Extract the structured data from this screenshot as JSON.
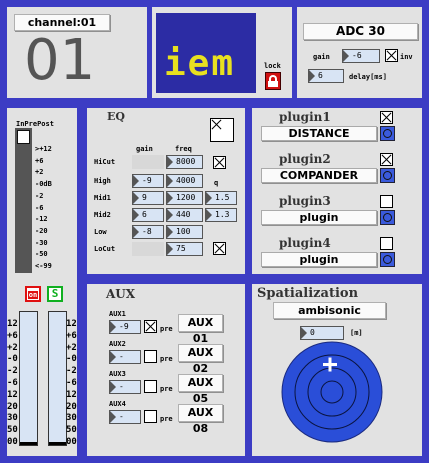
{
  "channel": {
    "title": "channel:01",
    "number": "01"
  },
  "header": {
    "logo_text": "iem",
    "lock_label": "lock",
    "adc_label": "ADC 30",
    "gain_label": "gain",
    "gain_value": "-6",
    "inv_label": "inv",
    "delay_value": "6",
    "delay_label": "delay[ms]"
  },
  "meter": {
    "header": "InPrePost",
    "scale": [
      ">+12",
      "+6",
      "+2",
      "-0dB",
      "-2",
      "-6",
      "-12",
      "-20",
      "-30",
      "-50",
      "<-99"
    ]
  },
  "buttons": {
    "mute": "on",
    "solo": "S"
  },
  "fader_scale": [
    "12",
    "+6",
    "+2",
    "-0",
    "-2",
    "-6",
    "12",
    "20",
    "30",
    "50",
    "00"
  ],
  "eq": {
    "title": "EQ",
    "gain_header": "gain",
    "freq_header": "freq",
    "q_header": "q",
    "bands": [
      {
        "name": "HiCut",
        "gain": "",
        "freq": "8000",
        "q": ""
      },
      {
        "name": "High",
        "gain": "-9",
        "freq": "4000",
        "q": ""
      },
      {
        "name": "Mid1",
        "gain": "9",
        "freq": "1200",
        "q": "1.5"
      },
      {
        "name": "Mid2",
        "gain": "6",
        "freq": "440",
        "q": "1.3"
      },
      {
        "name": "Low",
        "gain": "-8",
        "freq": "100",
        "q": ""
      },
      {
        "name": "LoCut",
        "gain": "",
        "freq": "75",
        "q": ""
      }
    ]
  },
  "plugins": [
    {
      "title": "plugin1",
      "name": "DISTANCE",
      "enabled": true
    },
    {
      "title": "plugin2",
      "name": "COMPANDER",
      "enabled": true
    },
    {
      "title": "plugin3",
      "name": "plugin",
      "enabled": false
    },
    {
      "title": "plugin4",
      "name": "plugin",
      "enabled": false
    }
  ],
  "aux": {
    "title": "AUX",
    "pre_label": "pre",
    "sends": [
      {
        "label": "AUX1",
        "value": "-9",
        "pre": true,
        "target": "AUX 01"
      },
      {
        "label": "AUX2",
        "value": "-",
        "pre": false,
        "target": "AUX 02"
      },
      {
        "label": "AUX3",
        "value": "-",
        "pre": false,
        "target": "AUX 05"
      },
      {
        "label": "AUX4",
        "value": "-",
        "pre": false,
        "target": "AUX 08"
      }
    ]
  },
  "spatial": {
    "title": "Spatialization",
    "mode": "ambisonic",
    "value": "0",
    "unit": "[m]"
  },
  "colors": {
    "frame": "#3c3cc4",
    "panel": "#e2e2e2",
    "logo_bg": "#2c2ca4",
    "logo_dot": "#e8e020",
    "radar": "#2a4ed8",
    "mute": "#e01010",
    "solo": "#10b020"
  }
}
